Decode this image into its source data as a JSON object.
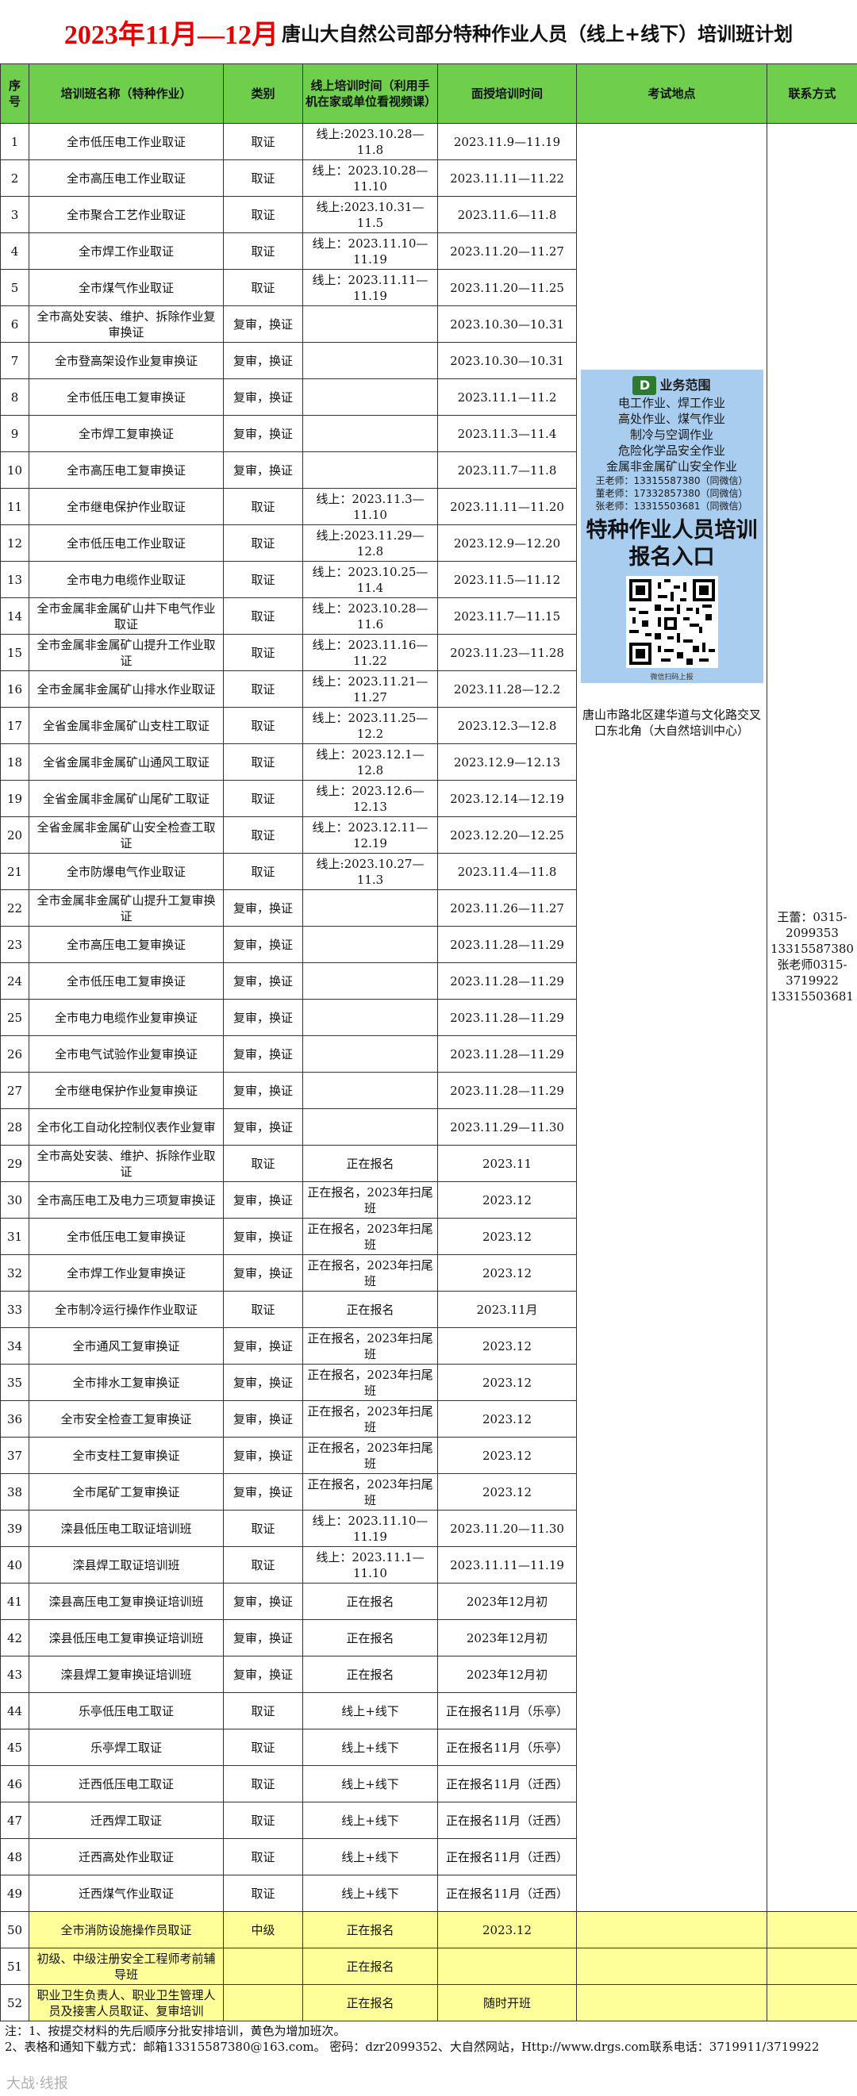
{
  "title": {
    "red": "2023年11月—12月",
    "black": "唐山大自然公司部分特种作业人员（线上+线下）培训班计划"
  },
  "headers": {
    "no": "序号",
    "name": "培训班名称（特种作业）",
    "type": "类别",
    "online": "线上培训时间（利用手机在家或单位看视频课）",
    "offline": "面授培训时间",
    "exam": "考试地点",
    "contact": "联系方式"
  },
  "rows": [
    {
      "no": "1",
      "name": "全市低压电工作业取证",
      "type": "取证",
      "online": "线上:2023.10.28—11.8",
      "offline": "2023.11.9—11.19"
    },
    {
      "no": "2",
      "name": "全市高压电工作业取证",
      "type": "取证",
      "online": "线上：2023.10.28—11.10",
      "offline": "2023.11.11—11.22"
    },
    {
      "no": "3",
      "name": "全市聚合工艺作业取证",
      "type": "取证",
      "online": "线上:2023.10.31—11.5",
      "offline": "2023.11.6—11.8"
    },
    {
      "no": "4",
      "name": "全市焊工作业取证",
      "type": "取证",
      "online": "线上：2023.11.10—11.19",
      "offline": "2023.11.20—11.27"
    },
    {
      "no": "5",
      "name": "全市煤气作业取证",
      "type": "取证",
      "online": "线上：2023.11.11—11.19",
      "offline": "2023.11.20—11.25"
    },
    {
      "no": "6",
      "name": "全市高处安装、维护、拆除作业复审换证",
      "type": "复审，换证",
      "online": "",
      "offline": "2023.10.30—10.31"
    },
    {
      "no": "7",
      "name": "全市登高架设作业复审换证",
      "type": "复审，换证",
      "online": "",
      "offline": "2023.10.30—10.31"
    },
    {
      "no": "8",
      "name": "全市低压电工复审换证",
      "type": "复审，换证",
      "online": "",
      "offline": "2023.11.1—11.2"
    },
    {
      "no": "9",
      "name": "全市焊工复审换证",
      "type": "复审，换证",
      "online": "",
      "offline": "2023.11.3—11.4"
    },
    {
      "no": "10",
      "name": "全市高压电工复审换证",
      "type": "复审，换证",
      "online": "",
      "offline": "2023.11.7—11.8"
    },
    {
      "no": "11",
      "name": "全市继电保护作业取证",
      "type": "取证",
      "online": "线上：2023.11.3—11.10",
      "offline": "2023.11.11—11.20"
    },
    {
      "no": "12",
      "name": "全市低压电工作业取证",
      "type": "取证",
      "online": "线上:2023.11.29—12.8",
      "offline": "2023.12.9—12.20"
    },
    {
      "no": "13",
      "name": "全市电力电缆作业取证",
      "type": "取证",
      "online": "线上：2023.10.25—11.4",
      "offline": "2023.11.5—11.12"
    },
    {
      "no": "14",
      "name": "全市金属非金属矿山井下电气作业取证",
      "type": "取证",
      "online": "线上：2023.10.28—11.6",
      "offline": "2023.11.7—11.15"
    },
    {
      "no": "15",
      "name": "全市金属非金属矿山提升工作业取证",
      "type": "取证",
      "online": "线上：2023.11.16—11.22",
      "offline": "2023.11.23—11.28"
    },
    {
      "no": "16",
      "name": "全市金属非金属矿山排水作业取证",
      "type": "取证",
      "online": "线上：2023.11.21—11.27",
      "offline": "2023.11.28—12.2"
    },
    {
      "no": "17",
      "name": "全省金属非金属矿山支柱工取证",
      "type": "取证",
      "online": "线上：2023.11.25—12.2",
      "offline": "2023.12.3—12.8"
    },
    {
      "no": "18",
      "name": "全省金属非金属矿山通风工取证",
      "type": "取证",
      "online": "线上：2023.12.1—12.8",
      "offline": "2023.12.9—12.13"
    },
    {
      "no": "19",
      "name": "全省金属非金属矿山尾矿工取证",
      "type": "取证",
      "online": "线上：2023.12.6—12.13",
      "offline": "2023.12.14—12.19"
    },
    {
      "no": "20",
      "name": "全省金属非金属矿山安全检查工取证",
      "type": "取证",
      "online": "线上：2023.12.11—12.19",
      "offline": "2023.12.20—12.25"
    },
    {
      "no": "21",
      "name": "全市防爆电气作业取证",
      "type": "取证",
      "online": "线上:2023.10.27—11.3",
      "offline": "2023.11.4—11.8"
    },
    {
      "no": "22",
      "name": "全市金属非金属矿山提升工复审换证",
      "type": "复审，换证",
      "online": "",
      "offline": "2023.11.26—11.27"
    },
    {
      "no": "23",
      "name": "全市高压电工复审换证",
      "type": "复审，换证",
      "online": "",
      "offline": "2023.11.28—11.29"
    },
    {
      "no": "24",
      "name": "全市低压电工复审换证",
      "type": "复审，换证",
      "online": "",
      "offline": "2023.11.28—11.29"
    },
    {
      "no": "25",
      "name": "全市电力电缆作业复审换证",
      "type": "复审，换证",
      "online": "",
      "offline": "2023.11.28—11.29"
    },
    {
      "no": "26",
      "name": "全市电气试验作业复审换证",
      "type": "复审，换证",
      "online": "",
      "offline": "2023.11.28—11.29"
    },
    {
      "no": "27",
      "name": "全市继电保护作业复审换证",
      "type": "复审，换证",
      "online": "",
      "offline": "2023.11.28—11.29"
    },
    {
      "no": "28",
      "name": "全市化工自动化控制仪表作业复审",
      "type": "复审，换证",
      "online": "",
      "offline": "2023.11.29—11.30"
    },
    {
      "no": "29",
      "name": "全市高处安装、维护、拆除作业取证",
      "type": "取证",
      "online": "正在报名",
      "offline": "2023.11"
    },
    {
      "no": "30",
      "name": "全市高压电工及电力三项复审换证",
      "type": "复审，换证",
      "online": "正在报名，2023年扫尾班",
      "offline": "2023.12"
    },
    {
      "no": "31",
      "name": "全市低压电工复审换证",
      "type": "复审，换证",
      "online": "正在报名，2023年扫尾班",
      "offline": "2023.12"
    },
    {
      "no": "32",
      "name": "全市焊工作业复审换证",
      "type": "复审，换证",
      "online": "正在报名，2023年扫尾班",
      "offline": "2023.12"
    },
    {
      "no": "33",
      "name": "全市制冷运行操作作业取证",
      "type": "取证",
      "online": "正在报名",
      "offline": "2023.11月"
    },
    {
      "no": "34",
      "name": "全市通风工复审换证",
      "type": "复审，换证",
      "online": "正在报名，2023年扫尾班",
      "offline": "2023.12"
    },
    {
      "no": "35",
      "name": "全市排水工复审换证",
      "type": "复审，换证",
      "online": "正在报名，2023年扫尾班",
      "offline": "2023.12"
    },
    {
      "no": "36",
      "name": "全市安全检查工复审换证",
      "type": "复审，换证",
      "online": "正在报名，2023年扫尾班",
      "offline": "2023.12"
    },
    {
      "no": "37",
      "name": "全市支柱工复审换证",
      "type": "复审，换证",
      "online": "正在报名，2023年扫尾班",
      "offline": "2023.12"
    },
    {
      "no": "38",
      "name": "全市尾矿工复审换证",
      "type": "复审，换证",
      "online": "正在报名，2023年扫尾班",
      "offline": "2023.12"
    },
    {
      "no": "39",
      "name": "滦县低压电工取证培训班",
      "type": "取证",
      "online": "线上：2023.11.10—11.19",
      "offline": "2023.11.20—11.30"
    },
    {
      "no": "40",
      "name": "滦县焊工取证培训班",
      "type": "取证",
      "online": "线上：2023.11.1—11.10",
      "offline": "2023.11.11—11.19"
    },
    {
      "no": "41",
      "name": "滦县高压电工复审换证培训班",
      "type": "复审，换证",
      "online": "正在报名",
      "offline": "2023年12月初"
    },
    {
      "no": "42",
      "name": "滦县低压电工复审换证培训班",
      "type": "复审，换证",
      "online": "正在报名",
      "offline": "2023年12月初"
    },
    {
      "no": "43",
      "name": "滦县焊工复审换证培训班",
      "type": "复审，换证",
      "online": "正在报名",
      "offline": "2023年12月初"
    },
    {
      "no": "44",
      "name": "乐亭低压电工取证",
      "type": "取证",
      "online": "线上+线下",
      "offline": "正在报名11月（乐亭）"
    },
    {
      "no": "45",
      "name": "乐亭焊工取证",
      "type": "取证",
      "online": "线上+线下",
      "offline": "正在报名11月（乐亭）"
    },
    {
      "no": "46",
      "name": "迁西低压电工取证",
      "type": "取证",
      "online": "线上+线下",
      "offline": "正在报名11月（迁西）"
    },
    {
      "no": "47",
      "name": "迁西焊工取证",
      "type": "取证",
      "online": "线上+线下",
      "offline": "正在报名11月（迁西）"
    },
    {
      "no": "48",
      "name": "迁西高处作业取证",
      "type": "取证",
      "online": "线上+线下",
      "offline": "正在报名11月（迁西）"
    },
    {
      "no": "49",
      "name": "迁西煤气作业取证",
      "type": "取证",
      "online": "线上+线下",
      "offline": "正在报名11月（迁西）"
    },
    {
      "no": "50",
      "name": "全市消防设施操作员取证",
      "type": "中级",
      "online": "正在报名",
      "offline": "2023.12",
      "yellow": true
    },
    {
      "no": "51",
      "name": "初级、中级注册安全工程师考前辅导班",
      "type": "",
      "online": "正在报名",
      "offline": "",
      "yellow": true
    },
    {
      "no": "52",
      "name": "职业卫生负责人、职业卫生管理人员及接害人员取证、复审培训",
      "type": "",
      "online": "正在报名",
      "offline": "随时开班",
      "yellow": true
    }
  ],
  "exam_location": "唐山市路北区建华道与文化路交叉口东北角（大自然培训中心）",
  "contact": "王蕾：0315-2099353 13315587380 张老师0315-3719922 13315503681",
  "qr_panel": {
    "logo": "D",
    "heading": "业务范围",
    "lines": [
      "电工作业、焊工作业",
      "高处作业、煤气作业",
      "制冷与空调作业",
      "危险化学品安全作业",
      "金属非金属矿山安全作业"
    ],
    "contacts": [
      "王老师：13315587380（同微信）",
      "董老师：17332857380（同微信）",
      "张老师：13315503681（同微信）"
    ],
    "big": "特种作业人员培训报名入口",
    "caption": "微信扫码上报"
  },
  "notes": [
    "注：1、按提交材料的先后顺序分批安排培训，黄色为增加班次。",
    "2、表格和通知下载方式：邮箱13315587380@163.com。    密码：dzr2099352、大自然网站，Http://www.drgs.com联系电话：3719911/3719922"
  ],
  "watermark": "大战·线报",
  "colors": {
    "title_red": "#e30000",
    "header_green": "#6fce4c",
    "yellow": "#ffff99",
    "qr_bg": "#a9cdef"
  }
}
